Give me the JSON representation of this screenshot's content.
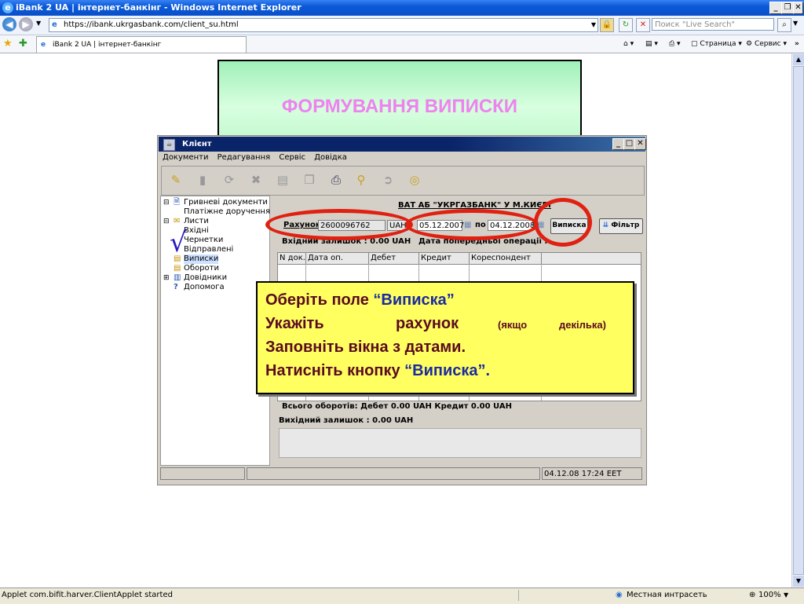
{
  "browser": {
    "title": "iBank 2 UA | інтернет-банкінг - Windows Internet Explorer",
    "url": "https://ibank.ukrgasbank.com/client_su.html",
    "search_placeholder": "Поиск \"Live Search\"",
    "tab_title": "iBank 2 UA | інтернет-банкінг",
    "cmd_page": "Страница",
    "cmd_service": "Сервис",
    "status_text": "Applet com.bifit.harver.ClientApplet started",
    "zone": "Местная интрасеть",
    "zoom": "100%"
  },
  "slide": {
    "title": "ФОРМУВАННЯ ВИПИСКИ"
  },
  "client": {
    "title": "Клієнт",
    "menu": [
      "Документи",
      "Редагування",
      "Сервіс",
      "Довідка"
    ],
    "tree": [
      {
        "label": "Гривневі документи",
        "level": 0
      },
      {
        "label": "Платіжне доручення",
        "level": 1
      },
      {
        "label": "Листи",
        "level": 0
      },
      {
        "label": "Вхідні",
        "level": 1
      },
      {
        "label": "Чернетки",
        "level": 1
      },
      {
        "label": "Відправлені",
        "level": 1
      },
      {
        "label": "Виписки",
        "level": 1
      },
      {
        "label": "Обороти",
        "level": 1
      },
      {
        "label": "Довідники",
        "level": 0
      },
      {
        "label": "Допомога",
        "level": 0
      }
    ],
    "bank_name": "ВАТ АБ \"УКРГАЗБАНК\" У М.КИЄВІ",
    "account_label": "Рахунок",
    "account_value": "2600096762",
    "currency": "UAH",
    "date_from": "05.12.2007",
    "date_to_label": "по",
    "date_to": "04.12.2008",
    "statement_button": "Виписка",
    "filter_button": "Фільтр",
    "opening_balance": "Вхідний залишок :   0.00   UAH",
    "prev_op_date": "Дата попередньої операції :",
    "columns": [
      "N док.",
      "Дата оп.",
      "Дебет",
      "Кредит",
      "Кореспондент"
    ],
    "turnover_total": "Всього оборотів:   Дебет   0.00   UAH   Кредит   0.00   UAH",
    "closing_balance": "Вихідний залишок :   0.00   UAH",
    "status_datetime": "04.12.08 17:24 EET"
  },
  "note": {
    "line1_a": "Оберіть поле ",
    "line1_b": "“Виписка”",
    "line2_a": "Укажіть",
    "line2_b": "рахунок",
    "line2_c": "(якщо",
    "line2_d": "декілька)",
    "line3": "Заповніть вікна з датами.",
    "line4_a": "Натисніть кнопку ",
    "line4_b": "“Виписка”.",
    "checkmark": "√"
  },
  "colors": {
    "highlight_ring": "#e02010",
    "note_bg": "#ffff60",
    "slide_title": "#ee82ee"
  }
}
